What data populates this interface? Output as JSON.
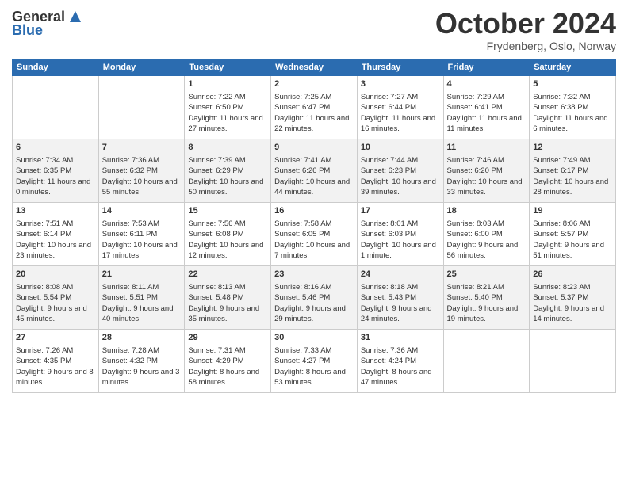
{
  "header": {
    "logo_line1": "General",
    "logo_line2": "Blue",
    "month": "October 2024",
    "location": "Frydenberg, Oslo, Norway"
  },
  "weekdays": [
    "Sunday",
    "Monday",
    "Tuesday",
    "Wednesday",
    "Thursday",
    "Friday",
    "Saturday"
  ],
  "rows": [
    [
      {
        "day": "",
        "sunrise": "",
        "sunset": "",
        "daylight": ""
      },
      {
        "day": "",
        "sunrise": "",
        "sunset": "",
        "daylight": ""
      },
      {
        "day": "1",
        "sunrise": "Sunrise: 7:22 AM",
        "sunset": "Sunset: 6:50 PM",
        "daylight": "Daylight: 11 hours and 27 minutes."
      },
      {
        "day": "2",
        "sunrise": "Sunrise: 7:25 AM",
        "sunset": "Sunset: 6:47 PM",
        "daylight": "Daylight: 11 hours and 22 minutes."
      },
      {
        "day": "3",
        "sunrise": "Sunrise: 7:27 AM",
        "sunset": "Sunset: 6:44 PM",
        "daylight": "Daylight: 11 hours and 16 minutes."
      },
      {
        "day": "4",
        "sunrise": "Sunrise: 7:29 AM",
        "sunset": "Sunset: 6:41 PM",
        "daylight": "Daylight: 11 hours and 11 minutes."
      },
      {
        "day": "5",
        "sunrise": "Sunrise: 7:32 AM",
        "sunset": "Sunset: 6:38 PM",
        "daylight": "Daylight: 11 hours and 6 minutes."
      }
    ],
    [
      {
        "day": "6",
        "sunrise": "Sunrise: 7:34 AM",
        "sunset": "Sunset: 6:35 PM",
        "daylight": "Daylight: 11 hours and 0 minutes."
      },
      {
        "day": "7",
        "sunrise": "Sunrise: 7:36 AM",
        "sunset": "Sunset: 6:32 PM",
        "daylight": "Daylight: 10 hours and 55 minutes."
      },
      {
        "day": "8",
        "sunrise": "Sunrise: 7:39 AM",
        "sunset": "Sunset: 6:29 PM",
        "daylight": "Daylight: 10 hours and 50 minutes."
      },
      {
        "day": "9",
        "sunrise": "Sunrise: 7:41 AM",
        "sunset": "Sunset: 6:26 PM",
        "daylight": "Daylight: 10 hours and 44 minutes."
      },
      {
        "day": "10",
        "sunrise": "Sunrise: 7:44 AM",
        "sunset": "Sunset: 6:23 PM",
        "daylight": "Daylight: 10 hours and 39 minutes."
      },
      {
        "day": "11",
        "sunrise": "Sunrise: 7:46 AM",
        "sunset": "Sunset: 6:20 PM",
        "daylight": "Daylight: 10 hours and 33 minutes."
      },
      {
        "day": "12",
        "sunrise": "Sunrise: 7:49 AM",
        "sunset": "Sunset: 6:17 PM",
        "daylight": "Daylight: 10 hours and 28 minutes."
      }
    ],
    [
      {
        "day": "13",
        "sunrise": "Sunrise: 7:51 AM",
        "sunset": "Sunset: 6:14 PM",
        "daylight": "Daylight: 10 hours and 23 minutes."
      },
      {
        "day": "14",
        "sunrise": "Sunrise: 7:53 AM",
        "sunset": "Sunset: 6:11 PM",
        "daylight": "Daylight: 10 hours and 17 minutes."
      },
      {
        "day": "15",
        "sunrise": "Sunrise: 7:56 AM",
        "sunset": "Sunset: 6:08 PM",
        "daylight": "Daylight: 10 hours and 12 minutes."
      },
      {
        "day": "16",
        "sunrise": "Sunrise: 7:58 AM",
        "sunset": "Sunset: 6:05 PM",
        "daylight": "Daylight: 10 hours and 7 minutes."
      },
      {
        "day": "17",
        "sunrise": "Sunrise: 8:01 AM",
        "sunset": "Sunset: 6:03 PM",
        "daylight": "Daylight: 10 hours and 1 minute."
      },
      {
        "day": "18",
        "sunrise": "Sunrise: 8:03 AM",
        "sunset": "Sunset: 6:00 PM",
        "daylight": "Daylight: 9 hours and 56 minutes."
      },
      {
        "day": "19",
        "sunrise": "Sunrise: 8:06 AM",
        "sunset": "Sunset: 5:57 PM",
        "daylight": "Daylight: 9 hours and 51 minutes."
      }
    ],
    [
      {
        "day": "20",
        "sunrise": "Sunrise: 8:08 AM",
        "sunset": "Sunset: 5:54 PM",
        "daylight": "Daylight: 9 hours and 45 minutes."
      },
      {
        "day": "21",
        "sunrise": "Sunrise: 8:11 AM",
        "sunset": "Sunset: 5:51 PM",
        "daylight": "Daylight: 9 hours and 40 minutes."
      },
      {
        "day": "22",
        "sunrise": "Sunrise: 8:13 AM",
        "sunset": "Sunset: 5:48 PM",
        "daylight": "Daylight: 9 hours and 35 minutes."
      },
      {
        "day": "23",
        "sunrise": "Sunrise: 8:16 AM",
        "sunset": "Sunset: 5:46 PM",
        "daylight": "Daylight: 9 hours and 29 minutes."
      },
      {
        "day": "24",
        "sunrise": "Sunrise: 8:18 AM",
        "sunset": "Sunset: 5:43 PM",
        "daylight": "Daylight: 9 hours and 24 minutes."
      },
      {
        "day": "25",
        "sunrise": "Sunrise: 8:21 AM",
        "sunset": "Sunset: 5:40 PM",
        "daylight": "Daylight: 9 hours and 19 minutes."
      },
      {
        "day": "26",
        "sunrise": "Sunrise: 8:23 AM",
        "sunset": "Sunset: 5:37 PM",
        "daylight": "Daylight: 9 hours and 14 minutes."
      }
    ],
    [
      {
        "day": "27",
        "sunrise": "Sunrise: 7:26 AM",
        "sunset": "Sunset: 4:35 PM",
        "daylight": "Daylight: 9 hours and 8 minutes."
      },
      {
        "day": "28",
        "sunrise": "Sunrise: 7:28 AM",
        "sunset": "Sunset: 4:32 PM",
        "daylight": "Daylight: 9 hours and 3 minutes."
      },
      {
        "day": "29",
        "sunrise": "Sunrise: 7:31 AM",
        "sunset": "Sunset: 4:29 PM",
        "daylight": "Daylight: 8 hours and 58 minutes."
      },
      {
        "day": "30",
        "sunrise": "Sunrise: 7:33 AM",
        "sunset": "Sunset: 4:27 PM",
        "daylight": "Daylight: 8 hours and 53 minutes."
      },
      {
        "day": "31",
        "sunrise": "Sunrise: 7:36 AM",
        "sunset": "Sunset: 4:24 PM",
        "daylight": "Daylight: 8 hours and 47 minutes."
      },
      {
        "day": "",
        "sunrise": "",
        "sunset": "",
        "daylight": ""
      },
      {
        "day": "",
        "sunrise": "",
        "sunset": "",
        "daylight": ""
      }
    ]
  ]
}
